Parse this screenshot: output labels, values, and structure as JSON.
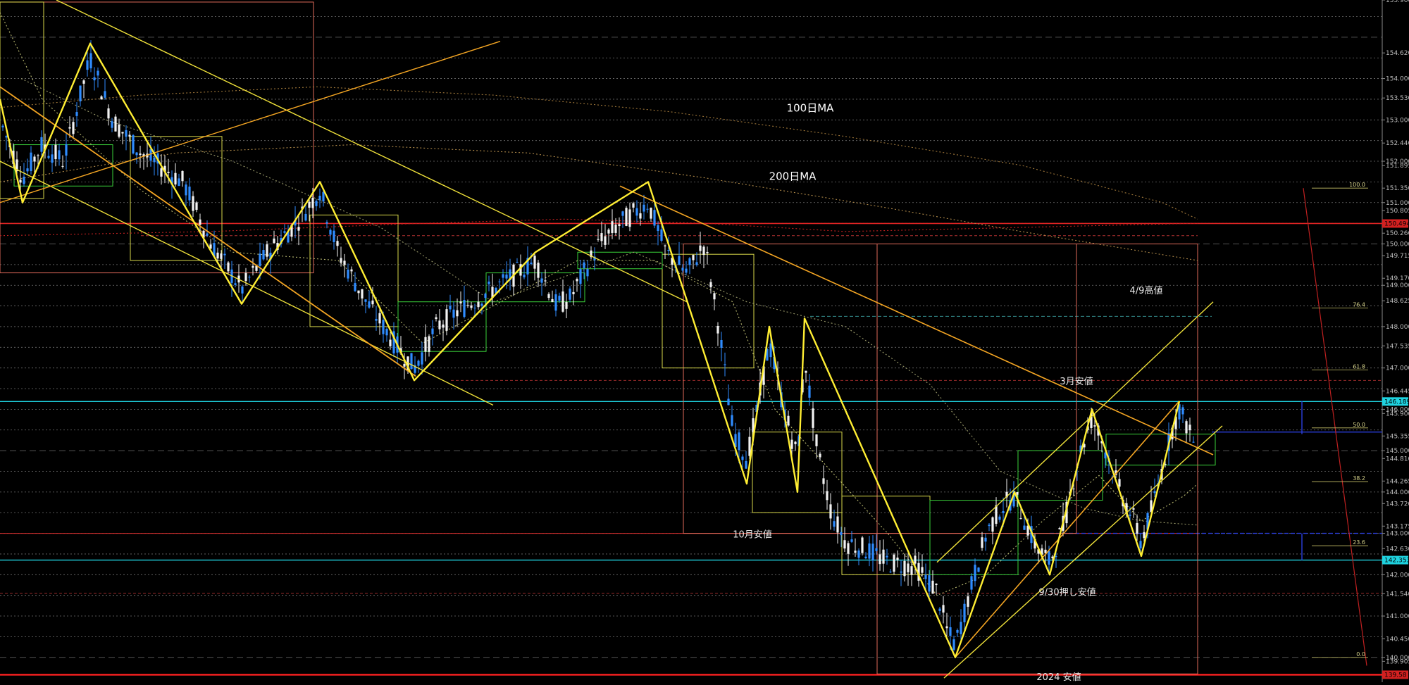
{
  "chart_data": {
    "type": "candlestick",
    "ylim": [
      139.4,
      155.9
    ],
    "price_axis": [
      "155.900",
      "154.620",
      "154.000",
      "153.530",
      "153.000",
      "152.440",
      "152.000",
      "151.895",
      "151.350",
      "151.000",
      "150.805",
      "150.260",
      "150.000",
      "149.715",
      "149.170",
      "149.000",
      "148.625",
      "148.000",
      "147.535",
      "147.000",
      "146.445",
      "146.000",
      "145.900",
      "145.355",
      "145.000",
      "144.810",
      "144.265",
      "144.000",
      "143.720",
      "143.175",
      "143.000",
      "142.630",
      "142.000",
      "141.540",
      "141.000",
      "140.450",
      "140.000",
      "139.905"
    ],
    "price_badges": [
      {
        "label": "150.494",
        "value": 150.494,
        "color": "#d22020"
      },
      {
        "label": "146.189",
        "value": 146.189,
        "color": "#1fd3e0"
      },
      {
        "label": "142.353",
        "value": 142.353,
        "color": "#1fd3e0"
      },
      {
        "label": "139.58",
        "value": 139.58,
        "color": "#d22020"
      }
    ],
    "annotations": [
      {
        "text": "100日MA",
        "x": 1150,
        "value": 153.2,
        "style": "ma"
      },
      {
        "text": "200日MA",
        "x": 1125,
        "value": 151.55,
        "style": "ma"
      },
      {
        "text": "4/9高値",
        "x": 1627,
        "value": 148.8,
        "style": "note"
      },
      {
        "text": "3月安値",
        "x": 1528,
        "value": 146.6,
        "style": "note"
      },
      {
        "text": "10月安値",
        "x": 1068,
        "value": 142.9,
        "style": "note"
      },
      {
        "text": "9/30押し安値",
        "x": 1515,
        "value": 141.5,
        "style": "note"
      },
      {
        "text": "2024 安値",
        "x": 1503,
        "value": 139.45,
        "style": "note"
      }
    ],
    "fib_levels": [
      {
        "label": "100.0",
        "value": 151.35
      },
      {
        "label": "76.4",
        "value": 148.45
      },
      {
        "label": "61.8",
        "value": 146.95
      },
      {
        "label": "50.0",
        "value": 145.55
      },
      {
        "label": "38.2",
        "value": 144.25
      },
      {
        "label": "23.6",
        "value": 142.7
      },
      {
        "label": "0.0",
        "value": 140.0
      }
    ],
    "zigzag": [
      {
        "x": 0,
        "value": 153.5
      },
      {
        "x": 32,
        "value": 151.0
      },
      {
        "x": 128,
        "value": 154.85
      },
      {
        "x": 343,
        "value": 148.55
      },
      {
        "x": 454,
        "value": 151.5
      },
      {
        "x": 588,
        "value": 146.7
      },
      {
        "x": 760,
        "value": 149.8
      },
      {
        "x": 920,
        "value": 151.5
      },
      {
        "x": 1060,
        "value": 144.2
      },
      {
        "x": 1092,
        "value": 148.0
      },
      {
        "x": 1132,
        "value": 144.0
      },
      {
        "x": 1142,
        "value": 148.2
      },
      {
        "x": 1356,
        "value": 140.0
      },
      {
        "x": 1440,
        "value": 144.0
      },
      {
        "x": 1490,
        "value": 142.0
      },
      {
        "x": 1550,
        "value": 146.0
      },
      {
        "x": 1620,
        "value": 142.45
      },
      {
        "x": 1674,
        "value": 146.2
      }
    ]
  }
}
